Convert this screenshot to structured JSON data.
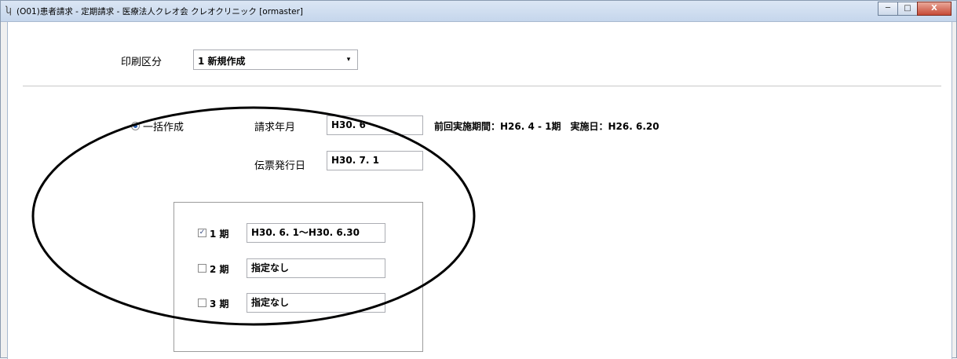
{
  "window": {
    "title": "(O01)患者請求 - 定期請求 - 医療法人クレオ会  クレオクリニック [ormaster]",
    "minimize_glyph": "─",
    "maximize_glyph": "□",
    "close_glyph": "X"
  },
  "print_section": {
    "label": "印刷区分",
    "selected": "1 新規作成",
    "arrow": "▾"
  },
  "batch": {
    "radio_label": "一括作成",
    "billing_month_label": "請求年月",
    "billing_month_value": "H30. 6",
    "previous_info": "前回実施期間：H26. 4 - 1期　実施日：H26. 6.20",
    "slip_date_label": "伝票発行日",
    "slip_date_value": "H30. 7. 1"
  },
  "periods": [
    {
      "label": "1 期",
      "checked": true,
      "value": "H30. 6. 1～H30. 6.30"
    },
    {
      "label": "2 期",
      "checked": false,
      "value": "指定なし"
    },
    {
      "label": "3 期",
      "checked": false,
      "value": "指定なし"
    }
  ],
  "colors": {
    "titlebar": "#c5d6ec",
    "close_button": "#c74a36",
    "annotation_oval": "#000000"
  }
}
